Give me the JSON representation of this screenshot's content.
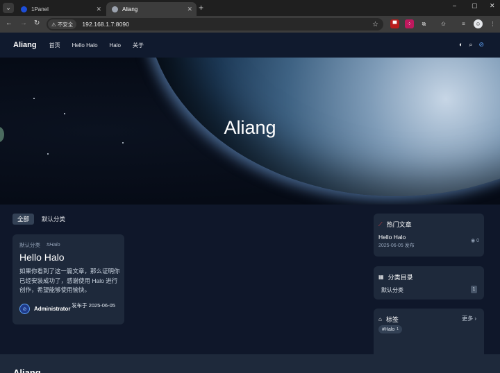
{
  "browser": {
    "tabs": [
      {
        "title": "1Panel",
        "active": false
      },
      {
        "title": "Aliang",
        "active": true
      }
    ],
    "new_tab": "+",
    "window_controls": {
      "minimize": "–",
      "maximize": "▢",
      "close": "✕"
    },
    "insecure_label": "不安全",
    "url": "192.168.1.7:8090"
  },
  "site": {
    "brand": "Aliang",
    "nav": [
      "首页",
      "Hello Halo",
      "Halo",
      "关于"
    ],
    "hero_title": "Aliang"
  },
  "filters": [
    "全部",
    "默认分类"
  ],
  "post": {
    "category": "默认分类",
    "tag": "#Halo",
    "title": "Hello Halo",
    "excerpt": "如果你看到了这一篇文章，那么证明你已经安装成功了，感谢使用 Halo 进行创作，希望能够使用愉快。",
    "author": "Administrator",
    "published": "发布于 2025-06-05"
  },
  "widgets": {
    "hot": {
      "title": "热门文章",
      "item_title": "Hello Halo",
      "item_date": "2025-06-05 发布",
      "item_views": "0"
    },
    "categories": {
      "title": "分类目录",
      "item": "默认分类",
      "count": "1"
    },
    "tags": {
      "title": "标签",
      "more": "更多",
      "chip": "#Halo",
      "chip_count": "1"
    }
  },
  "footer": {
    "brand": "Aliang"
  },
  "colors": {
    "accent": "#3b82f6",
    "background": "#0f172a",
    "card": "#1e293b"
  }
}
